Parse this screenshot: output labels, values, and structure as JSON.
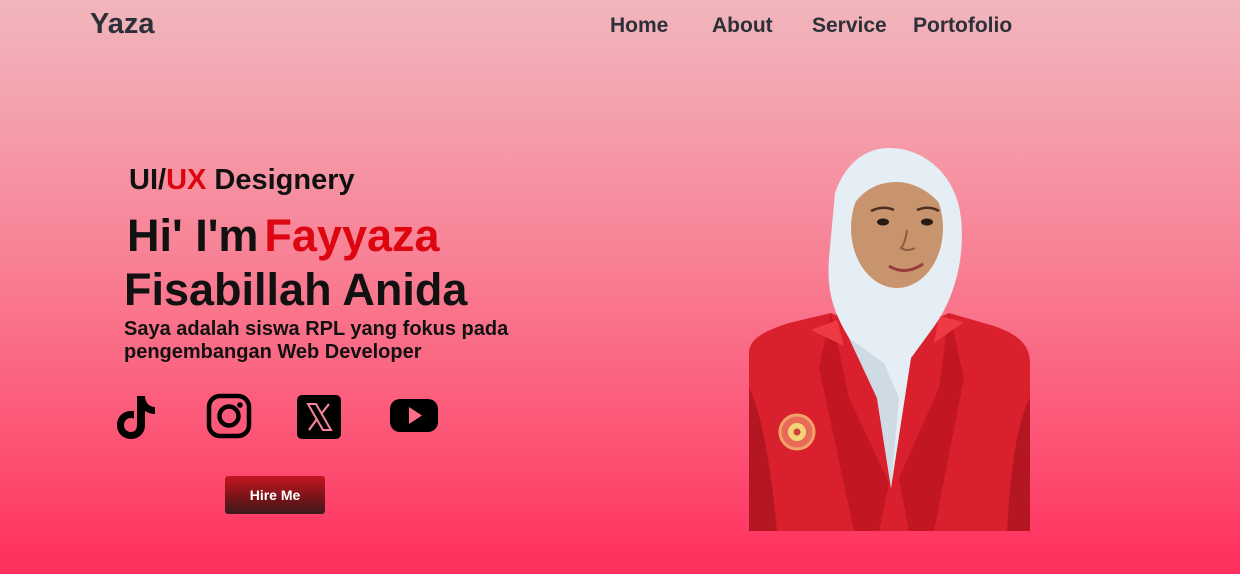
{
  "header": {
    "brand": "Yaza",
    "nav": [
      "Home",
      "About",
      "Service",
      "Portofolio"
    ]
  },
  "hero": {
    "tagline_pre": "UI/",
    "tagline_accent": "UX",
    "tagline_post": " Designery",
    "greeting": "Hi' I'm",
    "first_name": "Fayyaza",
    "last_name": "Fisabillah Anida",
    "description": "Saya adalah siswa RPL yang fokus pada pengembangan Web Developer",
    "cta_label": "Hire Me"
  },
  "social": {
    "icons": [
      "tiktok-icon",
      "instagram-icon",
      "x-icon",
      "youtube-icon"
    ]
  },
  "colors": {
    "accent": "#dc0510",
    "nav_text": "#2d3038",
    "background_top": "#f1b6bd",
    "background_bottom": "#fe2e5c",
    "blazer": "#d9202c",
    "hijab": "#e4eef4"
  }
}
